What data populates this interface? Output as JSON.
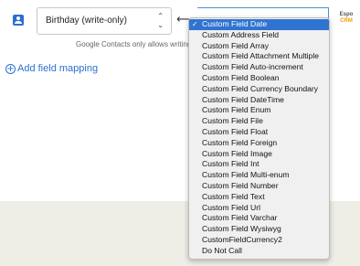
{
  "source_field": {
    "value": "Birthday (write-only)",
    "arrows": "⌃\n⌄"
  },
  "mapping_arrow": "⟵",
  "hint_text": "Google Contacts only allows writing",
  "add_mapping_label": "Add field mapping",
  "espo_logo": {
    "line1": "Espo",
    "line2": "CRM"
  },
  "dropdown": {
    "selected_check": "✓",
    "options": [
      "Custom Field Date",
      "Custom Address Field",
      "Custom Field Array",
      "Custom Field Attachment Multiple",
      "Custom Field Auto-increment",
      "Custom Field Boolean",
      "Custom Field Currency Boundary",
      "Custom Field DateTime",
      "Custom Field Enum",
      "Custom Field File",
      "Custom Field Float",
      "Custom Field Foreign",
      "Custom Field Image",
      "Custom Field Int",
      "Custom Field Multi-enum",
      "Custom Field Number",
      "Custom Field Text",
      "Custom Field Url",
      "Custom Field Varchar",
      "Custom Field Wysiwyg",
      "CustomFieldCurrency2",
      "Do Not Call"
    ]
  },
  "colors": {
    "accent": "#2c6fd1",
    "selected_bg": "#2f74d0",
    "footer_bg": "#eeede6"
  }
}
